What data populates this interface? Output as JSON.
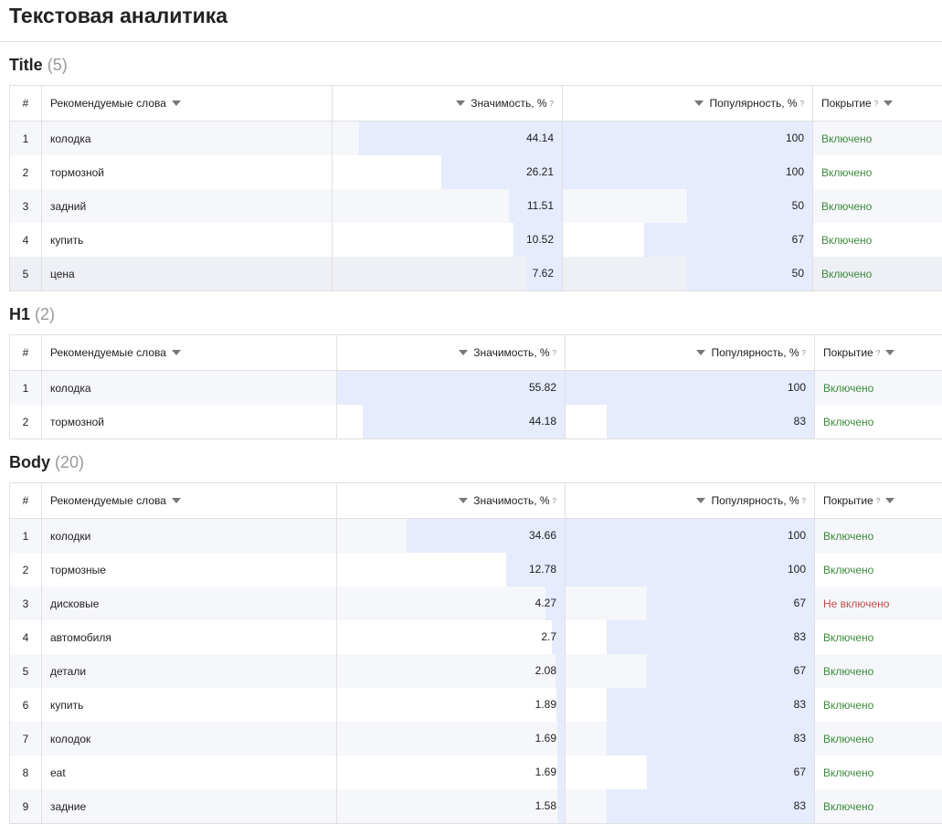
{
  "page_title": "Текстовая аналитика",
  "columns": {
    "num": "#",
    "words": "Рекомендуемые слова",
    "significance": "Значимость, %",
    "popularity": "Популярность, %",
    "coverage": "Покрытие",
    "help": "?"
  },
  "colors": {
    "bar": "#e6ebfd",
    "included": "#3d8b3d",
    "not_included": "#c44c4c"
  },
  "sections": [
    {
      "title": "Title",
      "count": "(5)",
      "rows": [
        {
          "n": "1",
          "word": "колодка",
          "sig": "44.14",
          "pop": "100",
          "cov": "Включено",
          "ok": true
        },
        {
          "n": "2",
          "word": "тормозной",
          "sig": "26.21",
          "pop": "100",
          "cov": "Включено",
          "ok": true
        },
        {
          "n": "3",
          "word": "задний",
          "sig": "11.51",
          "pop": "50",
          "cov": "Включено",
          "ok": true
        },
        {
          "n": "4",
          "word": "купить",
          "sig": "10.52",
          "pop": "67",
          "cov": "Включено",
          "ok": true
        },
        {
          "n": "5",
          "word": "цена",
          "sig": "7.62",
          "pop": "50",
          "cov": "Включено",
          "ok": true
        }
      ]
    },
    {
      "title": "H1",
      "count": "(2)",
      "rows": [
        {
          "n": "1",
          "word": "колодка",
          "sig": "55.82",
          "pop": "100",
          "cov": "Включено",
          "ok": true
        },
        {
          "n": "2",
          "word": "тормозной",
          "sig": "44.18",
          "pop": "83",
          "cov": "Включено",
          "ok": true
        }
      ]
    },
    {
      "title": "Body",
      "count": "(20)",
      "rows": [
        {
          "n": "1",
          "word": "колодки",
          "sig": "34.66",
          "pop": "100",
          "cov": "Включено",
          "ok": true
        },
        {
          "n": "2",
          "word": "тормозные",
          "sig": "12.78",
          "pop": "100",
          "cov": "Включено",
          "ok": true
        },
        {
          "n": "3",
          "word": "дисковые",
          "sig": "4.27",
          "pop": "67",
          "cov": "Не включено",
          "ok": false
        },
        {
          "n": "4",
          "word": "автомобиля",
          "sig": "2.7",
          "pop": "83",
          "cov": "Включено",
          "ok": true
        },
        {
          "n": "5",
          "word": "детали",
          "sig": "2.08",
          "pop": "67",
          "cov": "Включено",
          "ok": true
        },
        {
          "n": "6",
          "word": "купить",
          "sig": "1.89",
          "pop": "83",
          "cov": "Включено",
          "ok": true
        },
        {
          "n": "7",
          "word": "колодок",
          "sig": "1.69",
          "pop": "83",
          "cov": "Включено",
          "ok": true
        },
        {
          "n": "8",
          "word": "eat",
          "sig": "1.69",
          "pop": "67",
          "cov": "Включено",
          "ok": true
        },
        {
          "n": "9",
          "word": "задние",
          "sig": "1.58",
          "pop": "83",
          "cov": "Включено",
          "ok": true
        }
      ]
    }
  ]
}
